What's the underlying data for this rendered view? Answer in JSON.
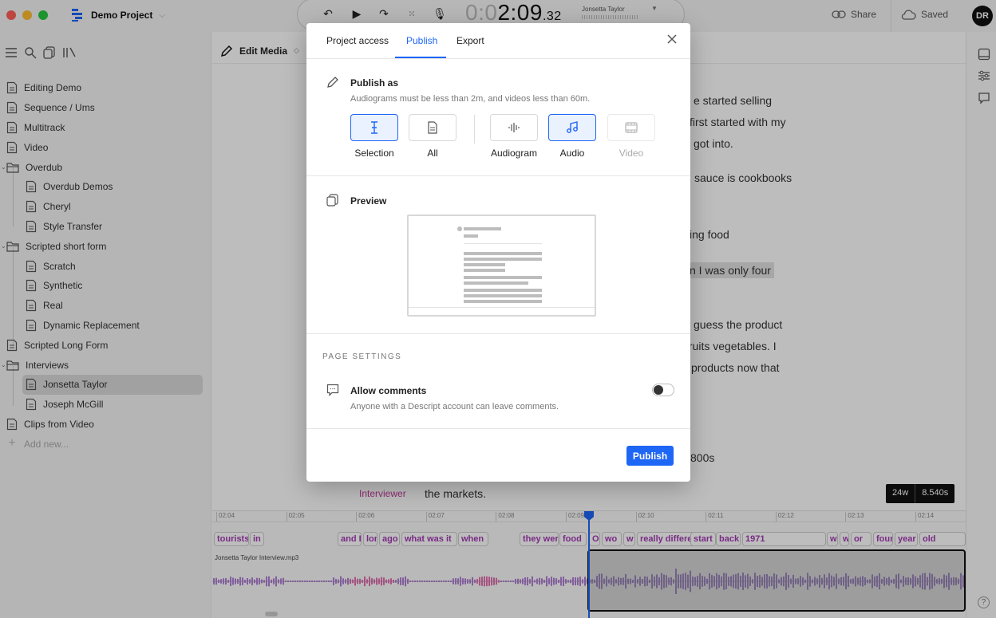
{
  "titlebar": {
    "project_name": "Demo Project",
    "timecode_dim": "0:0",
    "timecode_main": "2:09",
    "timecode_frac": ".32",
    "speaker": "Jonsetta Taylor",
    "share_label": "Share",
    "saved_label": "Saved",
    "avatar": "DR"
  },
  "sidebar": {
    "items": [
      {
        "label": "Editing Demo"
      },
      {
        "label": "Sequence / Ums"
      },
      {
        "label": "Multitrack"
      },
      {
        "label": "Video"
      },
      {
        "label": "Overdub"
      },
      {
        "label": "Overdub Demos"
      },
      {
        "label": "Cheryl"
      },
      {
        "label": "Style Transfer"
      },
      {
        "label": "Scripted short form"
      },
      {
        "label": "Scratch"
      },
      {
        "label": "Synthetic"
      },
      {
        "label": "Real"
      },
      {
        "label": "Dynamic Replacement"
      },
      {
        "label": "Scripted Long Form"
      },
      {
        "label": "Interviews"
      },
      {
        "label": "Jonsetta Taylor"
      },
      {
        "label": "Joseph McGill"
      },
      {
        "label": "Clips from Video"
      },
      {
        "label": "Add new..."
      }
    ]
  },
  "main": {
    "header_label": "Edit Media",
    "transcript_lines": [
      "e started selling",
      "first started with my",
      "got into.",
      "sauce is cookbooks",
      "ing food",
      "n I was only four",
      "guess the product",
      "fruits vegetables. I",
      "products now that",
      "800s"
    ],
    "speaker_label": "Interviewer",
    "last_line": "the markets.",
    "word_count": "24w",
    "duration": "8.540s"
  },
  "timeline": {
    "ticks": [
      "02:04",
      "02:05",
      "02:06",
      "02:07",
      "02:08",
      "02:09",
      "02:10",
      "02:11",
      "02:12",
      "02:13",
      "02:14"
    ],
    "words": [
      "tourists",
      "in",
      "and I",
      "long",
      "ago",
      "what was it",
      "when",
      "they were",
      "food",
      "O",
      "wo",
      "w",
      "really different",
      "start",
      "back",
      "1971",
      "w",
      "w",
      "or",
      "four",
      "year",
      "old"
    ],
    "clip_name": "Jonsetta Taylor Interview.mp3"
  },
  "modal": {
    "tabs": [
      "Project access",
      "Publish",
      "Export"
    ],
    "active_tab": "Publish",
    "publish_as_title": "Publish as",
    "publish_as_sub": "Audiograms must be less than 2m, and videos less than 60m.",
    "publish_types": [
      {
        "label": "Selection",
        "icon": "text-cursor-icon",
        "selected": true
      },
      {
        "label": "All",
        "icon": "document-icon",
        "selected": false
      },
      {
        "label": "Audiogram",
        "icon": "waveform-icon",
        "selected": false
      },
      {
        "label": "Audio",
        "icon": "music-note-icon",
        "selected": true
      },
      {
        "label": "Video",
        "icon": "film-icon",
        "selected": false,
        "disabled": true
      }
    ],
    "preview_title": "Preview",
    "settings_header": "PAGE SETTINGS",
    "allow_comments_title": "Allow comments",
    "allow_comments_sub": "Anyone with a Descript account can leave comments.",
    "allow_comments_on": false,
    "publish_button": "Publish"
  },
  "colors": {
    "accent": "#1e66f5",
    "word_text": "#a33ab3",
    "waveform": "#b07fd6",
    "waveform_pink": "#e06fb0"
  }
}
